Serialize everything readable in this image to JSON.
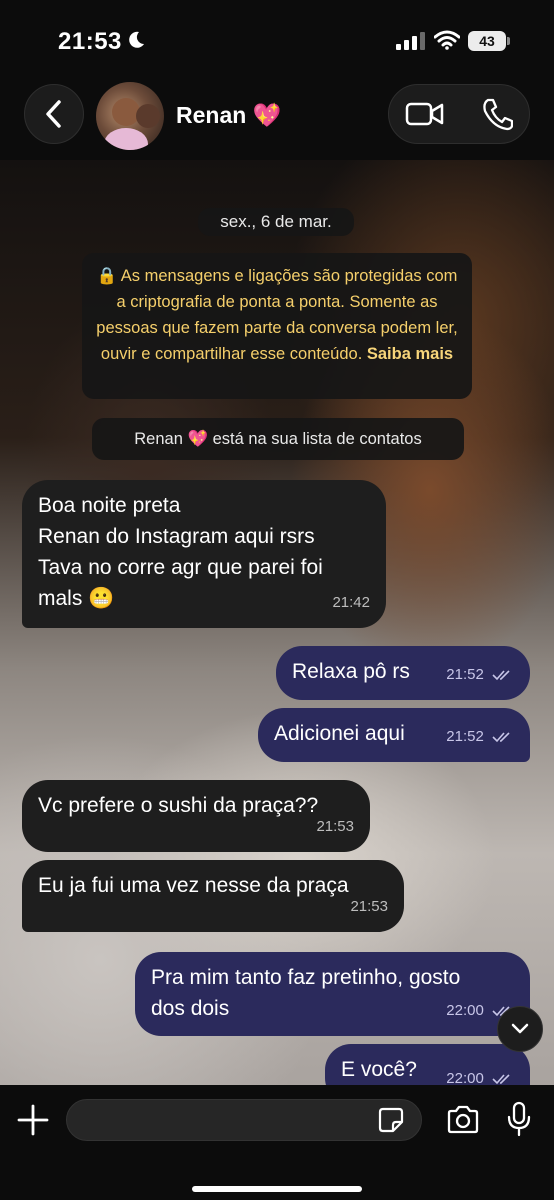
{
  "status_bar": {
    "time": "21:53",
    "battery": "43"
  },
  "header": {
    "contact_name": "Renan 💖"
  },
  "system": {
    "date_chip": "sex., 6 de mar.",
    "encryption_text": "🔒 As mensagens e ligações são protegidas com a criptografia de ponta a ponta. Somente as pessoas que fazem parte da conversa podem ler, ouvir e compartilhar esse conteúdo.",
    "encryption_link": "Saiba mais",
    "contact_notice": "Renan 💖  está na sua lista de contatos"
  },
  "messages": [
    {
      "direction": "in",
      "lines": [
        "Boa noite preta",
        "Renan do Instagram aqui rsrs",
        "Tava no corre agr que parei foi",
        "mals 😬"
      ],
      "time": "21:42"
    },
    {
      "direction": "out",
      "lines": [
        "Relaxa pô rs"
      ],
      "time": "21:52"
    },
    {
      "direction": "out",
      "lines": [
        "Adicionei aqui"
      ],
      "time": "21:52"
    },
    {
      "direction": "in",
      "lines": [
        "Vc prefere o sushi da praça??"
      ],
      "time": "21:53"
    },
    {
      "direction": "in",
      "lines": [
        "Eu ja fui uma vez nesse da praça"
      ],
      "time": "21:53"
    },
    {
      "direction": "out",
      "lines": [
        "Pra mim tanto faz pretinho, gosto",
        "dos dois"
      ],
      "time": "22:00"
    },
    {
      "direction": "out",
      "lines": [
        "E você?"
      ],
      "time": "22:00"
    }
  ],
  "colors": {
    "incoming_bubble": "#1e1e1e",
    "outgoing_bubble": "#2b2a5c",
    "encryption_text": "#f5cf6b"
  }
}
